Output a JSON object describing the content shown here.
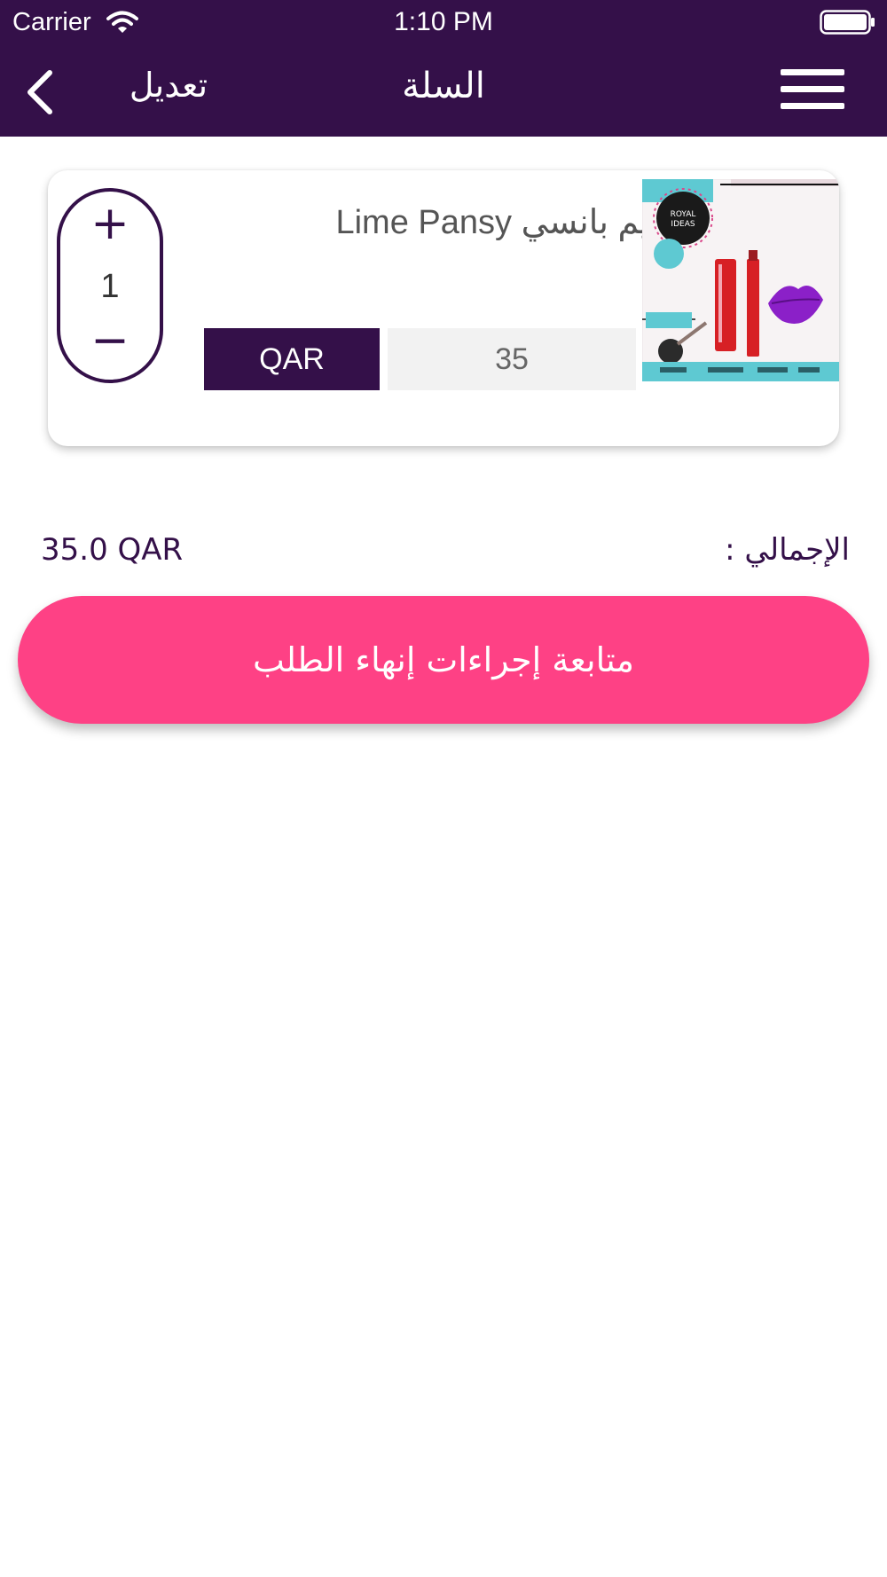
{
  "status_bar": {
    "carrier": "Carrier",
    "time": "1:10 PM"
  },
  "header": {
    "edit_label": "تعديل",
    "title": "السلة",
    "back_icon": "chevron-left-icon",
    "menu_icon": "hamburger-menu-icon"
  },
  "cart": {
    "items": [
      {
        "name": "لايم بانسي Lime Pansy",
        "quantity": "1",
        "plus_label": "+",
        "minus_label": "−",
        "price": "35",
        "currency": "QAR",
        "image_brand_lettering": "ROYAL IDEAS"
      }
    ]
  },
  "summary": {
    "total_label": "الإجمالي :",
    "total_value": "35.0 QAR"
  },
  "checkout": {
    "label": "متابعة إجراءات إنهاء الطلب"
  },
  "colors": {
    "primary": "#341049",
    "accent": "#fe4185",
    "price_bg": "#f2f2f2"
  }
}
